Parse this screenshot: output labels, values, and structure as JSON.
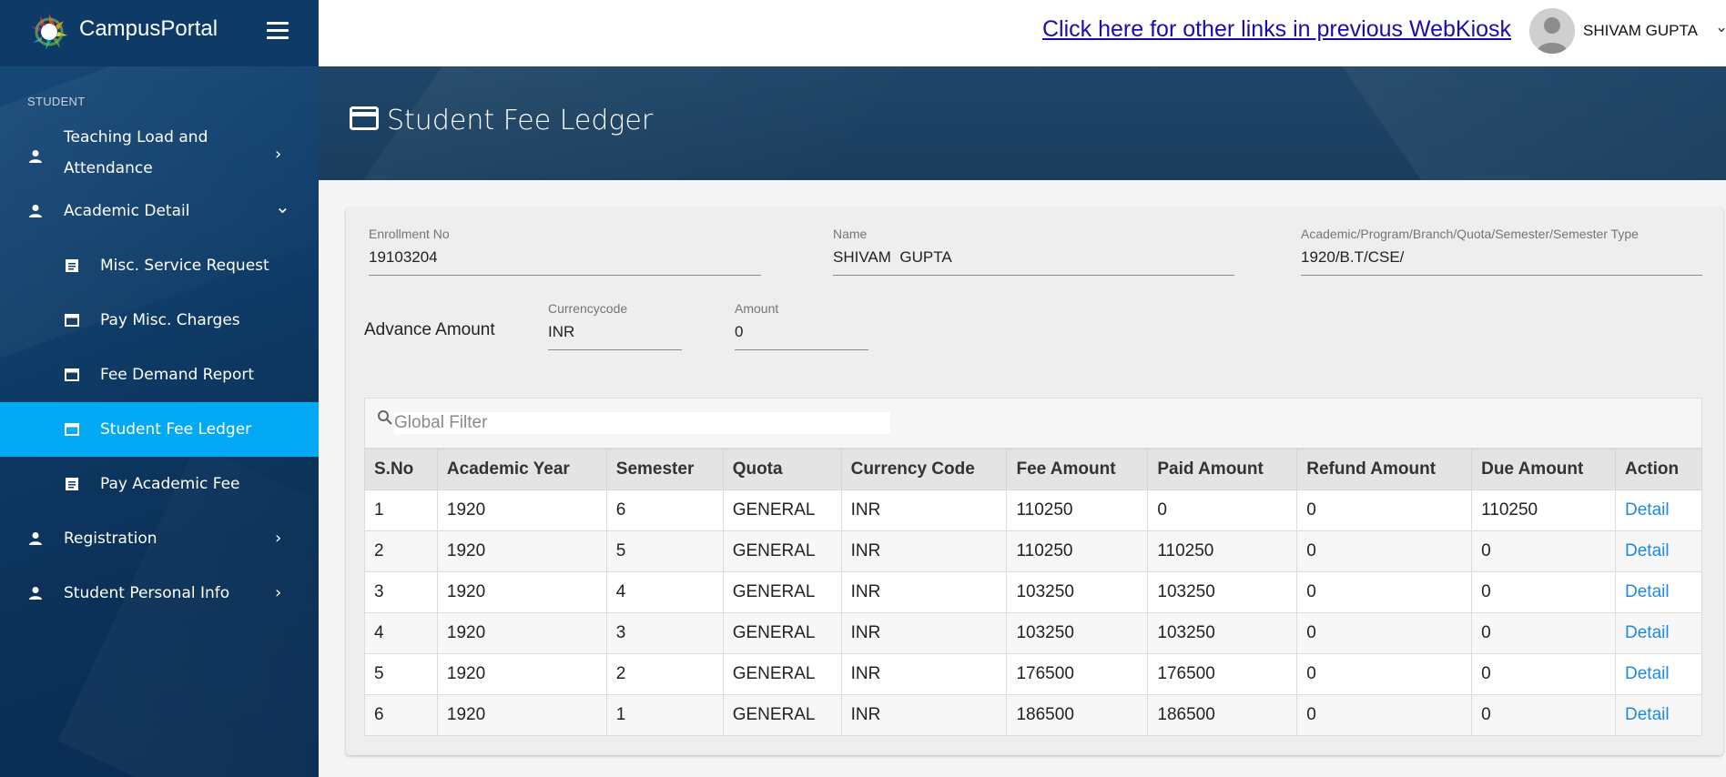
{
  "app": {
    "name": "CampusPortal"
  },
  "topbar": {
    "link_text": "Click here for other links in previous WebKiosk",
    "user_name": "SHIVAM GUPTA"
  },
  "sidebar": {
    "section": "STUDENT",
    "items": [
      {
        "label": "Teaching Load and",
        "label2": "Attendance",
        "icon": "person-icon",
        "chevron": "›"
      },
      {
        "label": "Academic Detail",
        "icon": "person-icon",
        "chevron": "⌄"
      },
      {
        "label": "Misc. Service Request",
        "icon": "document-icon"
      },
      {
        "label": "Pay Misc. Charges",
        "icon": "window-icon"
      },
      {
        "label": "Fee Demand Report",
        "icon": "window-icon"
      },
      {
        "label": "Student Fee Ledger",
        "icon": "window-icon",
        "active": true
      },
      {
        "label": "Pay Academic Fee",
        "icon": "document-icon"
      },
      {
        "label": "Registration",
        "icon": "person-icon",
        "chevron": "›"
      },
      {
        "label": "Student Personal Info",
        "icon": "person-icon",
        "chevron": "›"
      }
    ]
  },
  "page": {
    "title": "Student Fee Ledger"
  },
  "form": {
    "enrollment": {
      "label": "Enrollment No",
      "value": "19103204"
    },
    "name": {
      "label": "Name",
      "value": "SHIVAM  GUPTA"
    },
    "program": {
      "label": "Academic/Program/Branch/Quota/Semester/Semester Type",
      "value": "1920/B.T/CSE/"
    },
    "advance_label": "Advance Amount",
    "currency": {
      "label": "Currencycode",
      "value": "INR"
    },
    "amount": {
      "label": "Amount",
      "value": "0"
    }
  },
  "table": {
    "filter_placeholder": "Global Filter",
    "columns": [
      "S.No",
      "Academic Year",
      "Semester",
      "Quota",
      "Currency Code",
      "Fee Amount",
      "Paid Amount",
      "Refund Amount",
      "Due Amount",
      "Action"
    ],
    "rows": [
      [
        "1",
        "1920",
        "6",
        "GENERAL",
        "INR",
        "110250",
        "0",
        "0",
        "110250",
        "Detail"
      ],
      [
        "2",
        "1920",
        "5",
        "GENERAL",
        "INR",
        "110250",
        "110250",
        "0",
        "0",
        "Detail"
      ],
      [
        "3",
        "1920",
        "4",
        "GENERAL",
        "INR",
        "103250",
        "103250",
        "0",
        "0",
        "Detail"
      ],
      [
        "4",
        "1920",
        "3",
        "GENERAL",
        "INR",
        "103250",
        "103250",
        "0",
        "0",
        "Detail"
      ],
      [
        "5",
        "1920",
        "2",
        "GENERAL",
        "INR",
        "176500",
        "176500",
        "0",
        "0",
        "Detail"
      ],
      [
        "6",
        "1920",
        "1",
        "GENERAL",
        "INR",
        "186500",
        "186500",
        "0",
        "0",
        "Detail"
      ]
    ]
  },
  "colors": {
    "sidebar_active": "#03a9f4",
    "banner": "#1f4567",
    "link": "#1a0dab",
    "action": "#1e88e5"
  }
}
